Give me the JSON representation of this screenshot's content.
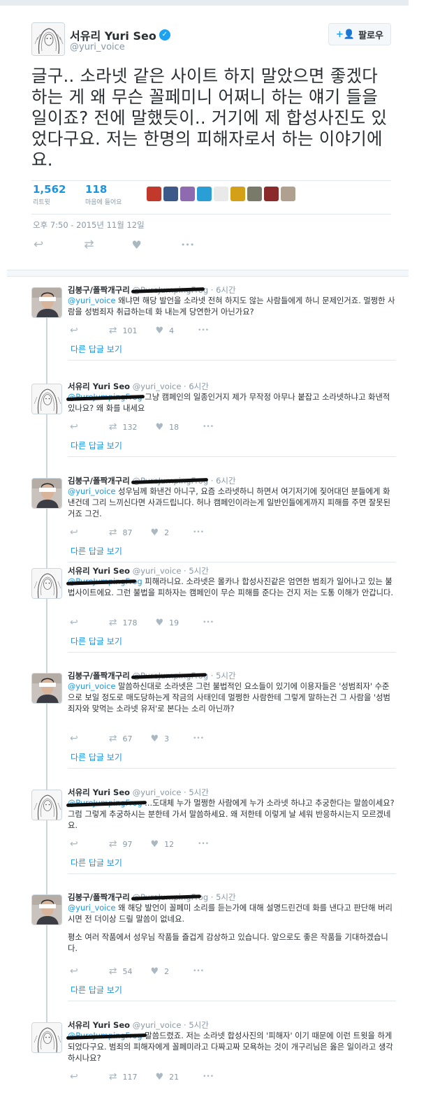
{
  "main": {
    "name": "서유리 Yuri Seo",
    "handle": "@yuri_voice",
    "verified_glyph": "✓",
    "follow_label": "팔로우",
    "follow_icon": "+👤",
    "text": "글구.. 소라넷 같은 사이트 하지 말았으면 좋겠다 하는 게 왜 무슨 꼴페미니 어쩌니 하는 얘기 들을 일이죠? 전에 말했듯이.. 거기에 제 합성사진도 있었다구요. 저는 한명의 피해자로서 하는 이야기에요.",
    "retweets": "1,562",
    "retweets_label": "리트윗",
    "likes": "118",
    "likes_label": "마음에 들어요",
    "timestamp": "오후 7:50 - 2015년 11월 12일",
    "liker_colors": [
      "#c0392b",
      "#3b5a8a",
      "#8e6bb0",
      "#2a9fd6",
      "#e9e9e9",
      "#d4a017",
      "#7a7a6a",
      "#8b2a2a",
      "#b0a090"
    ]
  },
  "icons": {
    "reply": "↩",
    "retweet": "⇄",
    "like": "♥",
    "more": "•••"
  },
  "replies": [
    {
      "name": "김봉구/폴짝개구리",
      "handle": "@PureJumpingFrog",
      "time": "· 6시간",
      "mention": "@yuri_voice",
      "text": " 왜냐면 해당 발언을 소라넷 전혀 하지도 않는 사람들에게 하니 문제인거죠. 멀쩡한 사람을 성범죄자 취급하는데 화 내는게 당연한거 아닌가요?",
      "text2": "",
      "retweets": "101",
      "likes": "4",
      "more_link": "다른 답글 보기"
    },
    {
      "name": "서유리 Yuri Seo",
      "handle": "@yuri_voice",
      "time": "· 6시간",
      "mention": "@PureJumpingFrog",
      "text": " 그냥 캠페인의 일종인거지 제가 무작정 아무나 붙잡고 소라넷하냐고 화낸적있나요? 왜 화를 내세요",
      "text2": "",
      "retweets": "132",
      "likes": "18",
      "more_link": "다른 답글 보기"
    },
    {
      "name": "김봉구/폴짝개구리",
      "handle": "@PureJumpingFrog",
      "time": "· 6시간",
      "mention": "@yuri_voice",
      "text": " 성우님께 화낸건 아니구, 요즘 소라넷하니 하면서 여기저기에 짖어대던 분들에게 화낸건데 그리 느끼신다면 사과드립니다. 허나 캠페인이라는게 일반인들에게까지 피해를 주면 잘못된 거죠 그건.",
      "text2": "",
      "retweets": "87",
      "likes": "2",
      "more_link": "다른 답글 보기"
    },
    {
      "name": "서유리 Yuri Seo",
      "handle": "@yuri_voice",
      "time": "· 5시간",
      "mention": "@PureJumpingFrog",
      "text": " 피해라니요. 소라넷은 몰카나 합성사진같은 엄연한 범죄가 일어나고 있는 불법사이트에요. 그런 불법을 피하자는 캠페인이 무슨 피해를 준다는 건지 저는 도통 이해가 안갑니다.",
      "text2": "",
      "retweets": "178",
      "likes": "19",
      "more_link": "다른 답글 보기"
    },
    {
      "name": "김봉구/폴짝개구리",
      "handle": "@PureJumpingFrog",
      "time": "· 5시간",
      "mention": "@yuri_voice",
      "text": " 말씀하신대로 소라넷은 그런 불법적인 요소들이 있기에 이용자들은 '성범죄자' 수준으로 보일 정도로 매도당하는게 작금의 사태인데 멀쩡한 사람한테 그렇게 말하는건 그 사람을 '성범죄자와 맞먹는 소라넷 유저'로 본다는 소리 아닌까?",
      "text2": "",
      "retweets": "67",
      "likes": "3",
      "more_link": "다른 답글 보기"
    },
    {
      "name": "서유리 Yuri Seo",
      "handle": "@yuri_voice",
      "time": "· 5시간",
      "mention": "@PureJumpingFrog",
      "text": " ...도대체 누가 멀쩡한 사람에게 누가 소라넷 하냐고 추궁한다는 말씀이세요? 그럼 그렇게 추궁하시는 분한테 가서 말씀하세요. 왜 저한테 이렇게 날 세워 반응하시는지 모르겠네요.",
      "text2": "",
      "retweets": "97",
      "likes": "12",
      "more_link": "다른 답글 보기"
    },
    {
      "name": "김봉구/폴짝개구리",
      "handle": "@PureJumpingFrog",
      "time": "· 5시간",
      "mention": "@yuri_voice",
      "text": " 왜 해당 발언이 꼴페미 소리를 듣는가에 대해 설명드린건데 화를 낸다고 판단해 버리시면 전 더이상 드릴 말씀이 없네요.",
      "text2": "평소 여러 작품에서 성우님 작품들 즐겁게 감상하고 있습니다. 앞으로도 좋은 작품들 기대하겠습니다.",
      "retweets": "54",
      "likes": "2",
      "more_link": "다른 답글 보기"
    },
    {
      "name": "서유리 Yuri Seo",
      "handle": "@yuri_voice",
      "time": "· 5시간",
      "mention": "@PureJumpingFrog",
      "text": " 말씀드렸죠. 저는 소라넷 합성사진의 '피해자' 이기 때문에 이런 트윗을 하게 되었다구요. 범죄의 피해자에게 꼴페미라고 다짜고짜 모욕하는 것이 개구리님은 옳은 일이라고 생각하시나요?",
      "text2": "",
      "retweets": "117",
      "likes": "21",
      "more_link": ""
    }
  ]
}
